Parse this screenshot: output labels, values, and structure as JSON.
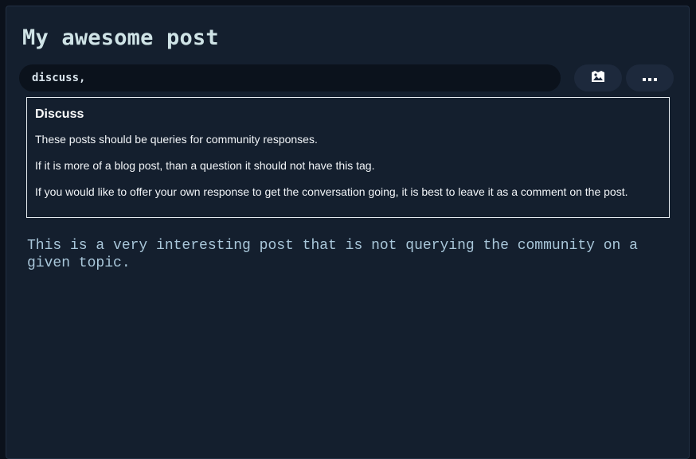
{
  "editor": {
    "title": "My awesome post",
    "tags_value": "discuss,",
    "body": "This is a very interesting post that is not querying the community on a\ngiven topic."
  },
  "toolbar": {
    "image_icon": "image-icon",
    "more_icon": "more-horizontal-icon"
  },
  "tag_help": {
    "title": "Discuss",
    "lines": [
      "These posts should be queries for community responses.",
      "If it is more of a blog post, than a question it should not have this tag.",
      "If you would like to offer your own response to get the conversation going, it is best to leave it as a comment on the post."
    ]
  },
  "colors": {
    "background": "#0b111b",
    "panel": "#141f2e",
    "input": "#0b121c",
    "button": "#1d293c",
    "title_text": "#cfe3e6",
    "body_text": "#a9c7da"
  }
}
